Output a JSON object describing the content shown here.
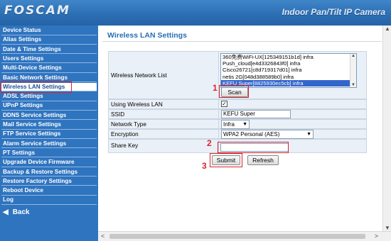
{
  "header": {
    "logo": "FOSCAM",
    "product": "Indoor Pan/Tilt IP Camera"
  },
  "sidebar": {
    "items": [
      {
        "label": "Device Status"
      },
      {
        "label": "Alias Settings"
      },
      {
        "label": "Date & Time Settings"
      },
      {
        "label": "Users Settings"
      },
      {
        "label": "Multi-Device Settings"
      },
      {
        "label": "Basic Network Settings"
      },
      {
        "label": "Wireless LAN Settings",
        "active": true
      },
      {
        "label": "ADSL Settings"
      },
      {
        "label": "UPnP Settings"
      },
      {
        "label": "DDNS Service Settings"
      },
      {
        "label": "Mail Service Settings"
      },
      {
        "label": "FTP Service Settings"
      },
      {
        "label": "Alarm Service Settings"
      },
      {
        "label": "PT Settings"
      },
      {
        "label": "Upgrade Device Firmware"
      },
      {
        "label": "Backup & Restore Settings"
      },
      {
        "label": "Restore Factory Settings"
      },
      {
        "label": "Reboot Device"
      },
      {
        "label": "Log"
      }
    ],
    "back_label": "Back"
  },
  "main": {
    "title": "Wireless LAN Settings",
    "network_list_label": "Wireless Network List",
    "networks": [
      "360免费WiFi-UX[125349151b1d] infra",
      "Push_cloud[e4d3326843f0] infra",
      "Cisco26721[c8d719317d01] infra",
      "netis 2G[048d388589b0] infra",
      "KEFU Super[8825930ec5cb] infra"
    ],
    "selected_network_index": 4,
    "scan_label": "Scan",
    "using_wireless_label": "Using Wireless LAN",
    "using_wireless_checked": true,
    "ssid_label": "SSID",
    "ssid_value": "KEFU Super",
    "network_type_label": "Network Type",
    "network_type_value": "Infra",
    "encryption_label": "Encryption",
    "encryption_value": "WPA2 Personal (AES)",
    "share_key_label": "Share Key",
    "share_key_value": "",
    "submit_label": "Submit",
    "refresh_label": "Refresh"
  },
  "annotations": {
    "step1": "1",
    "step2": "2",
    "step3": "3"
  },
  "colors": {
    "header": "#2d6fb4",
    "sidebar": "#2f74bf",
    "title": "#2a6db3",
    "annotation": "#d9232e"
  }
}
